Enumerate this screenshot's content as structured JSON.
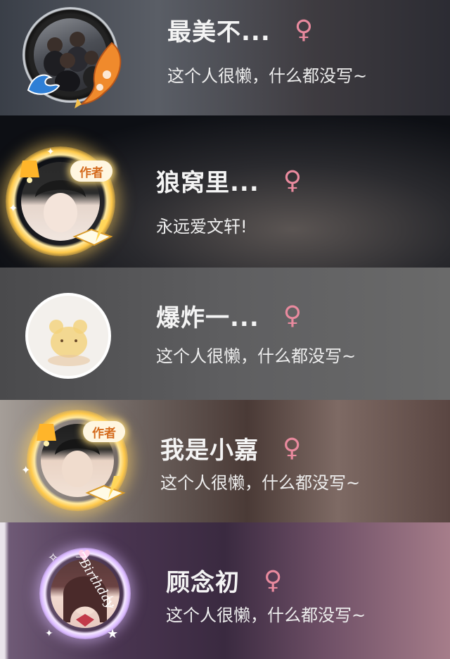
{
  "colors": {
    "gender_icon": "#e98a9e",
    "frame_gold": "#ffcc55",
    "frame_white": "#ffffff"
  },
  "users": [
    {
      "name": "最美不...",
      "gender_icon": "♀",
      "bio": "这个人很懒，什么都没写~"
    },
    {
      "name": "狼窝里...",
      "gender_icon": "♀",
      "bio": "永远爱文轩!",
      "badge": "作者"
    },
    {
      "name": "爆炸一...",
      "gender_icon": "♀",
      "bio": "这个人很懒，什么都没写~"
    },
    {
      "name": "我是小嘉",
      "gender_icon": "♀",
      "bio": "这个人很懒，什么都没写~",
      "badge": "作者"
    },
    {
      "name": "顾念初",
      "gender_icon": "♀",
      "bio": "这个人很懒，什么都没写~",
      "frame_text": "7Birthday"
    }
  ]
}
